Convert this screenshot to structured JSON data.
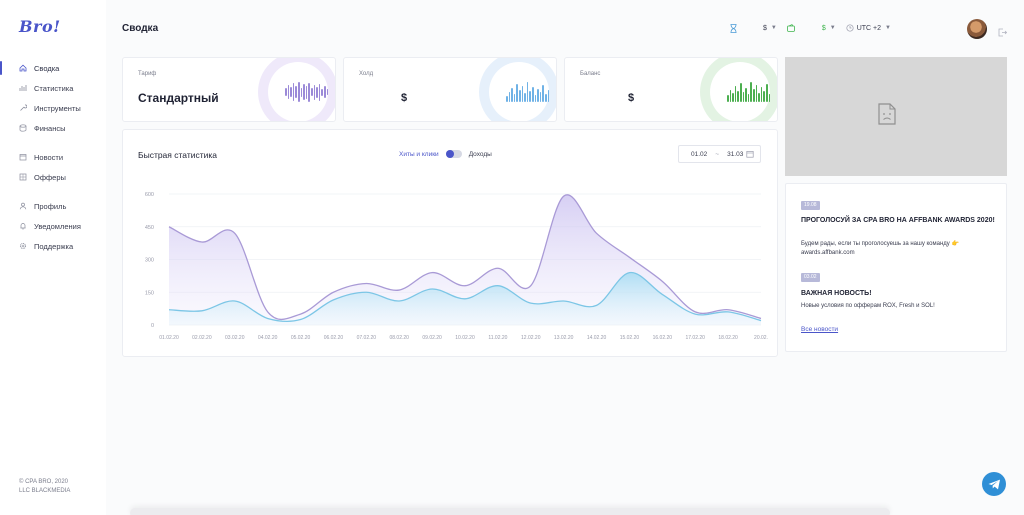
{
  "sidebar": {
    "logo": "Bro!",
    "items": [
      {
        "label": "Сводка",
        "icon": "home-icon",
        "active": true
      },
      {
        "label": "Статистика",
        "icon": "bar-chart-icon"
      },
      {
        "label": "Инструменты",
        "icon": "wrench-icon"
      },
      {
        "label": "Финансы",
        "icon": "database-icon"
      },
      {
        "label": "Новости",
        "icon": "calendar-icon"
      },
      {
        "label": "Офферы",
        "icon": "grid-icon"
      },
      {
        "label": "Профиль",
        "icon": "user-icon"
      },
      {
        "label": "Уведомления",
        "icon": "bell-icon"
      },
      {
        "label": "Поддержка",
        "icon": "gear-icon"
      }
    ],
    "footer_line1": "© CPA BRO, 2020",
    "footer_line2": "LLC BLACKMEDIA"
  },
  "header": {
    "title": "Сводка",
    "currency1": "$",
    "currency2": "$",
    "timezone": "UTC +2"
  },
  "cards": {
    "tariff": {
      "label": "Тариф",
      "value": "Стандартный"
    },
    "hold": {
      "label": "Холд",
      "value": "$"
    },
    "balance": {
      "label": "Баланс",
      "value": "$"
    }
  },
  "quick_stats": {
    "title": "Быстрая статистика",
    "toggle_left": "Хиты и клики",
    "toggle_right": "Доходы",
    "date_from": "01.02",
    "date_sep": "~",
    "date_to": "31.03"
  },
  "chart_data": {
    "type": "area",
    "x": [
      "01.02.20",
      "02.02.20",
      "03.02.20",
      "04.02.20",
      "05.02.20",
      "06.02.20",
      "07.02.20",
      "08.02.20",
      "09.02.20",
      "10.02.20",
      "11.02.20",
      "12.02.20",
      "13.02.20",
      "14.02.20",
      "15.02.20",
      "16.02.20",
      "17.02.20",
      "18.02.20",
      "20.02."
    ],
    "series": [
      {
        "values": [
          450,
          380,
          420,
          60,
          50,
          150,
          190,
          160,
          240,
          180,
          260,
          180,
          590,
          420,
          310,
          200,
          60,
          70,
          30
        ]
      },
      {
        "values": [
          70,
          65,
          110,
          30,
          25,
          115,
          150,
          110,
          165,
          120,
          180,
          100,
          110,
          90,
          240,
          140,
          50,
          60,
          20
        ]
      }
    ],
    "yticks": [
      "600",
      "450",
      "300",
      "150",
      "0"
    ],
    "ylim": [
      0,
      600
    ],
    "colors": {
      "purple": "#a99ad6",
      "blue": "#7cc6e6"
    }
  },
  "news": {
    "items": [
      {
        "date": "19.08",
        "title": "ПРОГОЛОСУЙ ЗА CPA BRO НА AFFBANK AWARDS 2020!",
        "body": "Будем рады, если ты проголосуешь за нашу команду 👉 awards.affbank.com"
      },
      {
        "date": "03.02",
        "title": "ВАЖНАЯ НОВОСТЬ!",
        "body": "Новые условия по офферам ROX, Fresh и SOL!"
      }
    ],
    "all_link": "Все новости"
  }
}
